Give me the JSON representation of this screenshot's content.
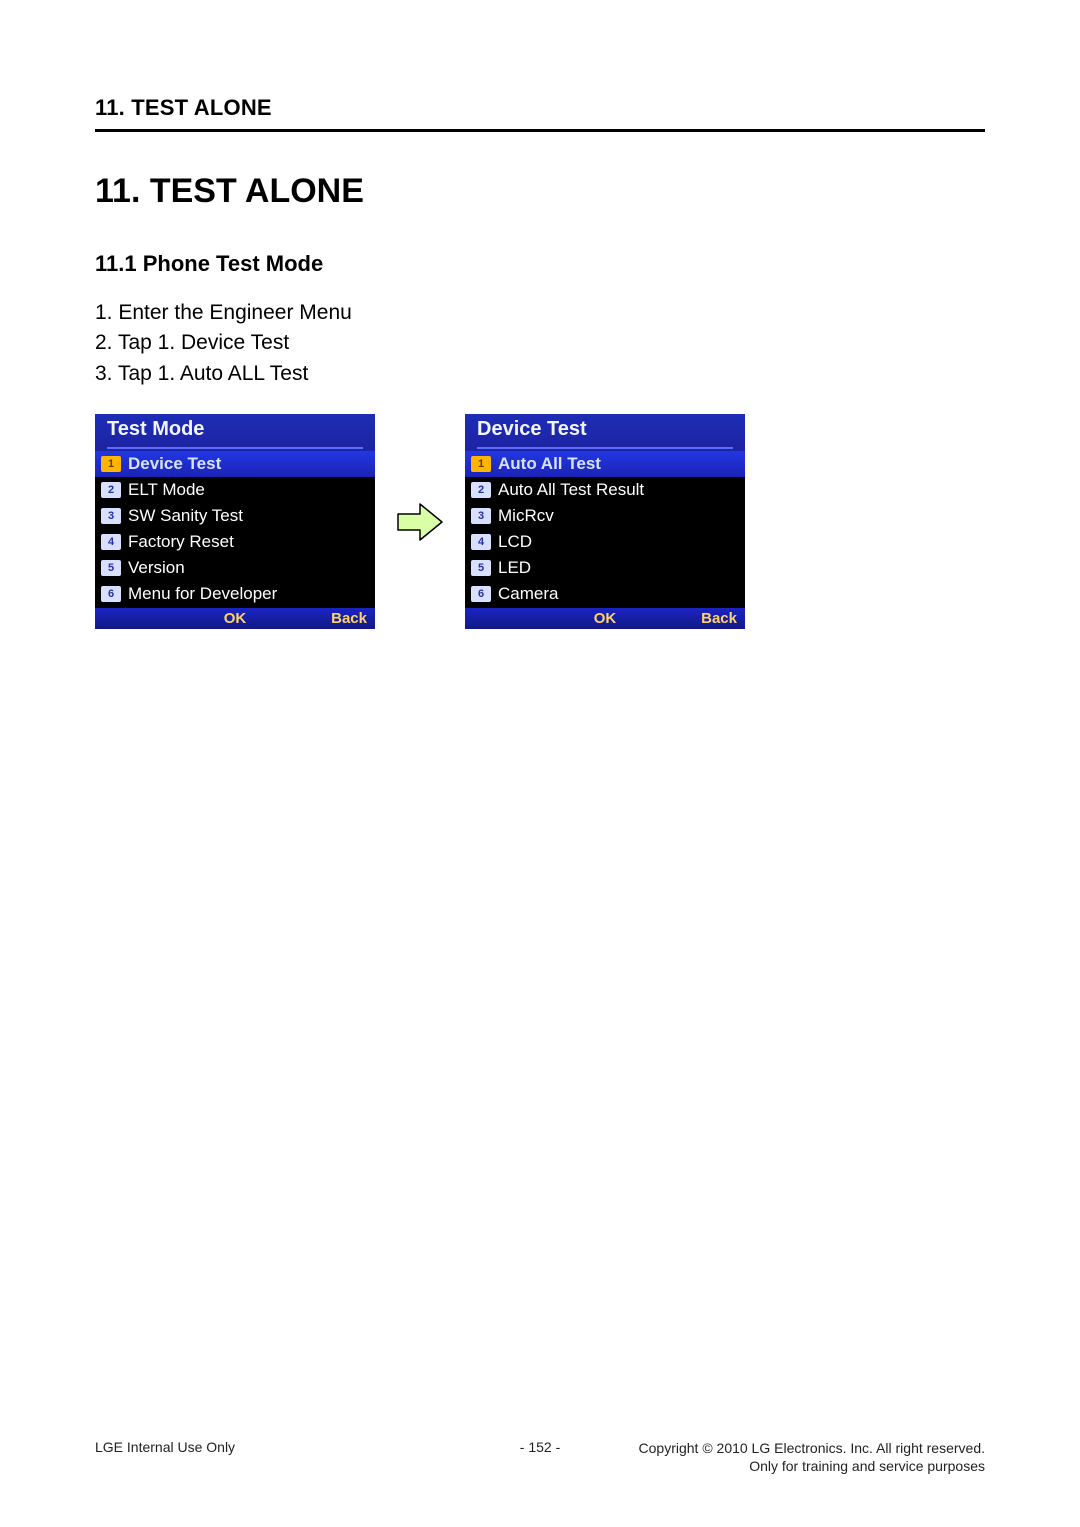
{
  "running_header": "11. TEST ALONE",
  "chapter_title": "11. TEST ALONE",
  "section_title": "11.1 Phone Test Mode",
  "steps": [
    "1. Enter the Engineer Menu",
    "2. Tap 1. Device Test",
    "3. Tap 1. Auto ALL Test"
  ],
  "screenshots": {
    "left": {
      "title": "Test Mode",
      "items": [
        {
          "num": "1",
          "label": "Device Test",
          "selected": true
        },
        {
          "num": "2",
          "label": "ELT Mode",
          "selected": false
        },
        {
          "num": "3",
          "label": "SW Sanity Test",
          "selected": false
        },
        {
          "num": "4",
          "label": "Factory Reset",
          "selected": false
        },
        {
          "num": "5",
          "label": "Version",
          "selected": false
        },
        {
          "num": "6",
          "label": "Menu for Developer",
          "selected": false
        }
      ],
      "softkeys": {
        "center": "OK",
        "right": "Back"
      }
    },
    "right": {
      "title": "Device Test",
      "items": [
        {
          "num": "1",
          "label": "Auto All Test",
          "selected": true
        },
        {
          "num": "2",
          "label": "Auto All Test Result",
          "selected": false
        },
        {
          "num": "3",
          "label": "MicRcv",
          "selected": false
        },
        {
          "num": "4",
          "label": "LCD",
          "selected": false
        },
        {
          "num": "5",
          "label": "LED",
          "selected": false
        },
        {
          "num": "6",
          "label": "Camera",
          "selected": false
        }
      ],
      "softkeys": {
        "center": "OK",
        "right": "Back"
      }
    }
  },
  "footer": {
    "left": "LGE Internal Use Only",
    "center": "- 152 -",
    "right_line1": "Copyright © 2010 LG Electronics. Inc. All right reserved.",
    "right_line2": "Only for training and service purposes"
  }
}
